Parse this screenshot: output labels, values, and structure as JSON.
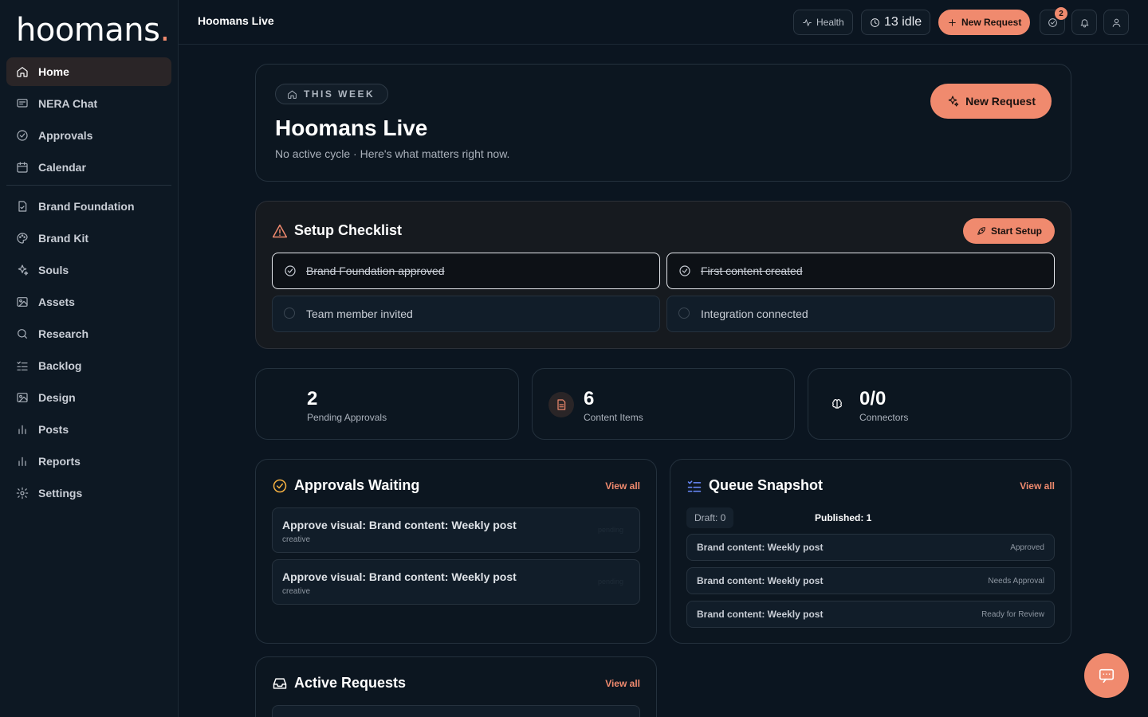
{
  "brand": {
    "logo_main": "hoomans",
    "logo_dot": ".",
    "accent": "#f08a6e"
  },
  "sidebar": {
    "items": [
      {
        "label": "Home",
        "icon": "home-icon",
        "active": true
      },
      {
        "label": "NERA Chat",
        "icon": "chat-icon"
      },
      {
        "label": "Approvals",
        "icon": "check-circle-icon"
      },
      {
        "label": "Calendar",
        "icon": "calendar-icon"
      },
      {
        "label": "Brand Foundation",
        "icon": "file-check-icon"
      },
      {
        "label": "Brand Kit",
        "icon": "palette-icon"
      },
      {
        "label": "Souls",
        "icon": "sparkles-icon"
      },
      {
        "label": "Assets",
        "icon": "image-icon"
      },
      {
        "label": "Research",
        "icon": "search-icon"
      },
      {
        "label": "Backlog",
        "icon": "list-check-icon"
      },
      {
        "label": "Design",
        "icon": "image-icon"
      },
      {
        "label": "Posts",
        "icon": "bar-chart-icon"
      },
      {
        "label": "Reports",
        "icon": "bar-chart-icon"
      },
      {
        "label": "Settings",
        "icon": "gear-icon"
      }
    ]
  },
  "topbar": {
    "title": "Hoomans Live",
    "health": "Health",
    "idle": "13 idle",
    "new_request": "New Request",
    "tasks_badge": "2"
  },
  "hero": {
    "pill": "THIS WEEK",
    "title": "Hoomans Live",
    "subtitle": "No active cycle · Here's what matters right now.",
    "button": "New Request"
  },
  "setup": {
    "title": "Setup Checklist",
    "button": "Start Setup",
    "items": [
      {
        "label": "Brand Foundation approved",
        "done": true
      },
      {
        "label": "First content created",
        "done": true
      },
      {
        "label": "Team member invited",
        "done": false
      },
      {
        "label": "Integration connected",
        "done": false
      }
    ]
  },
  "stats": [
    {
      "value": "2",
      "caption": "Pending Approvals"
    },
    {
      "value": "6",
      "caption": "Content Items"
    },
    {
      "value": "0/0",
      "caption": "Connectors"
    }
  ],
  "approvals": {
    "title": "Approvals Waiting",
    "view_all": "View all",
    "items": [
      {
        "title": "Approve visual: Brand content: Weekly post",
        "category": "creative",
        "status": "pending"
      },
      {
        "title": "Approve visual: Brand content: Weekly post",
        "category": "creative",
        "status": "pending"
      }
    ]
  },
  "queue": {
    "title": "Queue Snapshot",
    "view_all": "View all",
    "draft": "Draft: 0",
    "published": "Published: 1",
    "items": [
      {
        "title": "Brand content: Weekly post",
        "status": "Approved"
      },
      {
        "title": "Brand content: Weekly post",
        "status": "Needs Approval"
      },
      {
        "title": "Brand content: Weekly post",
        "status": "Ready for Review"
      }
    ]
  },
  "active_requests": {
    "title": "Active Requests",
    "view_all": "View all"
  }
}
